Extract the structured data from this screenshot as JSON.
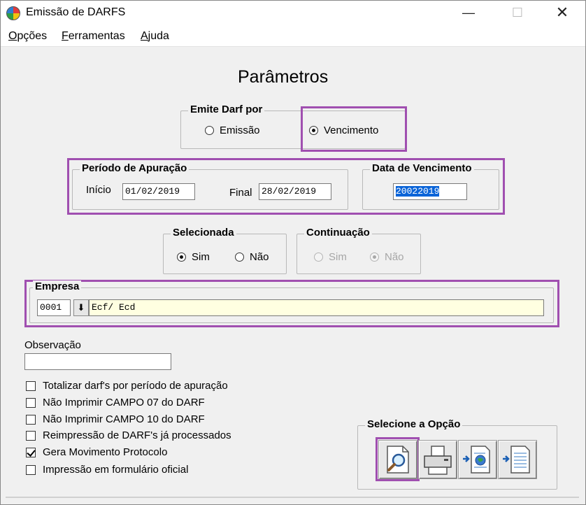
{
  "window": {
    "title": "Emissão de DARFS"
  },
  "titlebar_buttons": {
    "minimize": "—",
    "maximize": "☐",
    "close": "✕"
  },
  "menu": [
    {
      "accel": "O",
      "rest": "pções"
    },
    {
      "accel": "F",
      "rest": "erramentas"
    },
    {
      "accel": "A",
      "rest": "juda"
    }
  ],
  "heading": "Parâmetros",
  "emite_darf": {
    "label": "Emite Darf por",
    "options": [
      "Emissão",
      "Vencimento"
    ],
    "selected": "Vencimento"
  },
  "periodo": {
    "label": "Período de Apuração",
    "inicio_label": "Início",
    "inicio_value": "01/02/2019",
    "final_label": "Final",
    "final_value": "28/02/2019"
  },
  "vencimento": {
    "label": "Data de Vencimento",
    "value": "20022019"
  },
  "selecionada": {
    "label": "Selecionada",
    "sim": "Sim",
    "nao": "Não",
    "selected": "Sim"
  },
  "continuacao": {
    "label": "Continuação",
    "sim": "Sim",
    "nao": "Não",
    "selected": "Não",
    "disabled": true
  },
  "empresa": {
    "label": "Empresa",
    "code": "0001",
    "name": "Ecf/ Ecd"
  },
  "observacao": {
    "label": "Observação",
    "value": ""
  },
  "checkboxes": [
    {
      "label": "Totalizar darf's por período de apuração",
      "checked": false
    },
    {
      "label": "Não Imprimir CAMPO 07 do DARF",
      "checked": false
    },
    {
      "label": "Não Imprimir CAMPO 10 do DARF",
      "checked": false
    },
    {
      "label": "Reimpressão de DARF's já processados",
      "checked": false
    },
    {
      "label": "Gera Movimento Protocolo",
      "checked": true
    },
    {
      "label": "Impressão em formulário oficial",
      "checked": false
    }
  ],
  "opcao": {
    "label": "Selecione a Opção",
    "buttons": [
      "preview-icon",
      "printer-icon",
      "export-web-icon",
      "export-document-icon"
    ]
  },
  "colors": {
    "highlight": "#a04fb0",
    "selection": "#0a64d8",
    "empresa_name_bg": "#ffffe1"
  }
}
